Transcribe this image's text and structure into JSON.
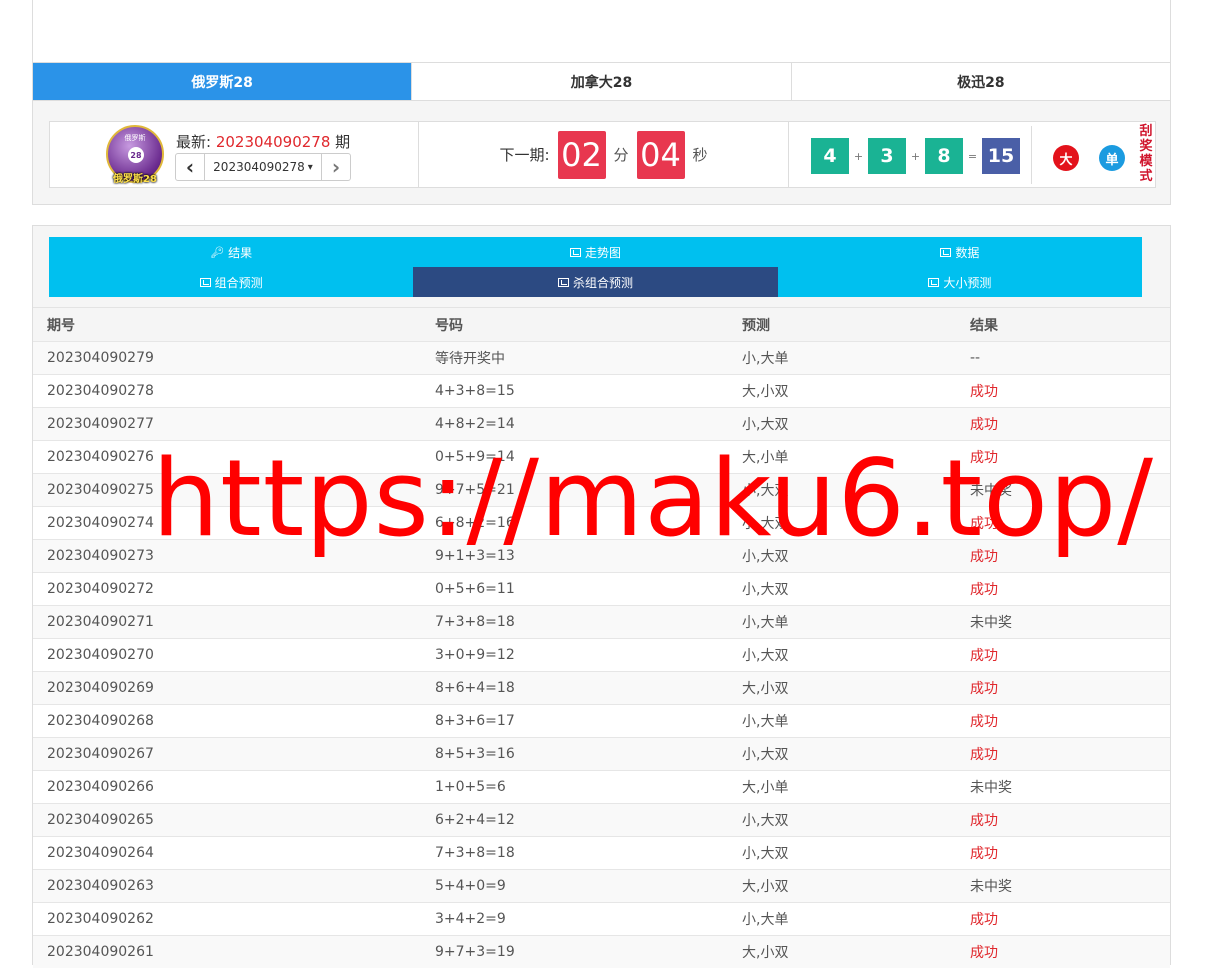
{
  "game_tabs": [
    {
      "label": "俄罗斯28",
      "active": true
    },
    {
      "label": "加拿大28",
      "active": false
    },
    {
      "label": "极迅28",
      "active": false
    }
  ],
  "info": {
    "logo_caption": "俄罗斯28",
    "logo_ball": "28",
    "logo_ring": "俄罗斯",
    "latest_label": "最新:",
    "latest_number": "202304090278",
    "latest_suffix": "期",
    "pager_prev": "‹",
    "pager_select": "202304090278",
    "pager_caret": "▾",
    "pager_next": "›",
    "next_label": "下一期:",
    "minutes": "02",
    "minutes_unit": "分",
    "seconds": "04",
    "seconds_unit": "秒",
    "balls": [
      "4",
      "3",
      "8"
    ],
    "plus": "+",
    "equals": "=",
    "sum": "15",
    "size_badge": "大",
    "parity_badge": "单",
    "scratch_link": "刮奖模式"
  },
  "nav_tabs": {
    "row1": [
      {
        "label": "结果",
        "icon": "key-icon"
      },
      {
        "label": "走势图",
        "icon": "chart-icon"
      },
      {
        "label": "数据",
        "icon": "chart-icon"
      }
    ],
    "row2": [
      {
        "label": "组合预测",
        "icon": "chart-icon",
        "active": false
      },
      {
        "label": "杀组合预测",
        "icon": "chart-icon",
        "active": true
      },
      {
        "label": "大小预测",
        "icon": "chart-icon",
        "active": false
      }
    ]
  },
  "table": {
    "headers": [
      "期号",
      "号码",
      "预测",
      "结果"
    ],
    "rows": [
      [
        "202304090279",
        "等待开奖中",
        "小,大单",
        "--"
      ],
      [
        "202304090278",
        "4+3+8=15",
        "大,小双",
        "成功"
      ],
      [
        "202304090277",
        "4+8+2=14",
        "小,大双",
        "成功"
      ],
      [
        "202304090276",
        "0+5+9=14",
        "大,小单",
        "成功"
      ],
      [
        "202304090275",
        "9+7+5=21",
        "小,大双",
        "未中奖"
      ],
      [
        "202304090274",
        "6+8+2=16",
        "小,大双",
        "成功"
      ],
      [
        "202304090273",
        "9+1+3=13",
        "小,大双",
        "成功"
      ],
      [
        "202304090272",
        "0+5+6=11",
        "小,大双",
        "成功"
      ],
      [
        "202304090271",
        "7+3+8=18",
        "小,大单",
        "未中奖"
      ],
      [
        "202304090270",
        "3+0+9=12",
        "小,大双",
        "成功"
      ],
      [
        "202304090269",
        "8+6+4=18",
        "大,小双",
        "成功"
      ],
      [
        "202304090268",
        "8+3+6=17",
        "小,大单",
        "成功"
      ],
      [
        "202304090267",
        "8+5+3=16",
        "小,大双",
        "成功"
      ],
      [
        "202304090266",
        "1+0+5=6",
        "大,小单",
        "未中奖"
      ],
      [
        "202304090265",
        "6+2+4=12",
        "小,大双",
        "成功"
      ],
      [
        "202304090264",
        "7+3+8=18",
        "小,大双",
        "成功"
      ],
      [
        "202304090263",
        "5+4+0=9",
        "大,小双",
        "未中奖"
      ],
      [
        "202304090262",
        "3+4+2=9",
        "小,大单",
        "成功"
      ],
      [
        "202304090261",
        "9+7+3=19",
        "大,小双",
        "成功"
      ]
    ]
  },
  "watermark": "https://maku6.top/",
  "colors": {
    "active_tab": "#2b93e8",
    "nav_tab": "#00c0ef",
    "nav_tab_active": "#2c4a82",
    "success_text": "#e0282d",
    "ball": "#1ab394",
    "sum_ball": "#4a5fa7",
    "timer": "#e8374f",
    "big_badge": "#e3121b",
    "odd_badge": "#1b9be0"
  }
}
